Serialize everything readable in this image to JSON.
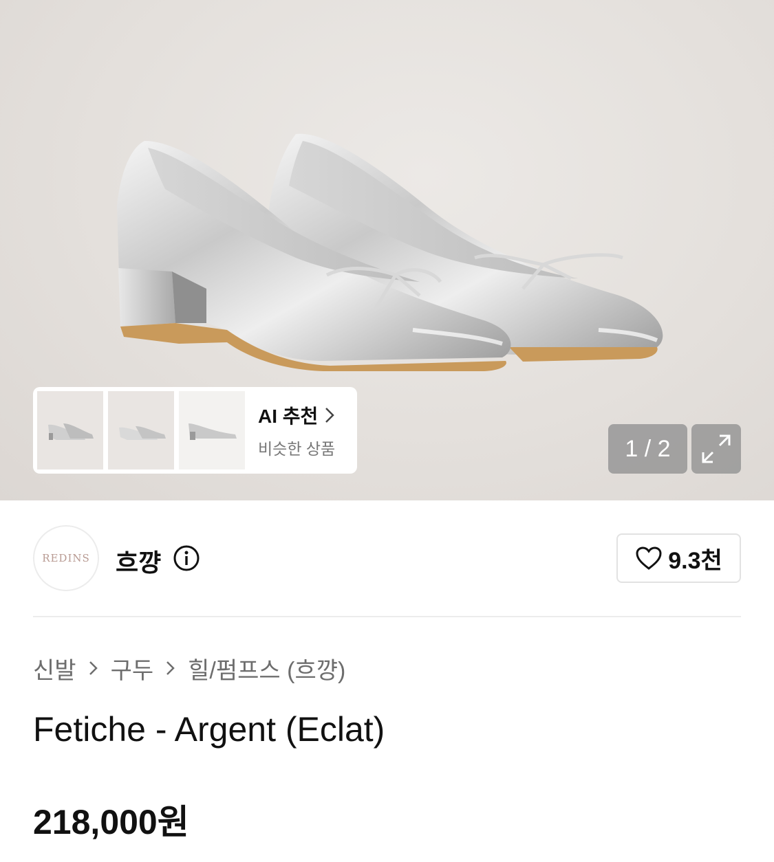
{
  "gallery": {
    "current_page": "1 / 2",
    "ai_recommend": {
      "title": "AI 추천",
      "subtitle": "비슷한 상품"
    },
    "expand_icon": "expand-icon"
  },
  "seller": {
    "logo_text": "REDINS",
    "name": "흐꺙",
    "info_icon": "info-icon",
    "likes": "9.3천"
  },
  "breadcrumb": [
    "신발",
    "구두",
    "힐/펌프스 (흐꺙)"
  ],
  "product": {
    "title": "Fetiche - Argent (Eclat)",
    "price": "218,000원"
  },
  "colors": {
    "hero_bg": "#e4e0dc",
    "pager_bg": "#969696",
    "muted_text": "#6d6d6d"
  }
}
